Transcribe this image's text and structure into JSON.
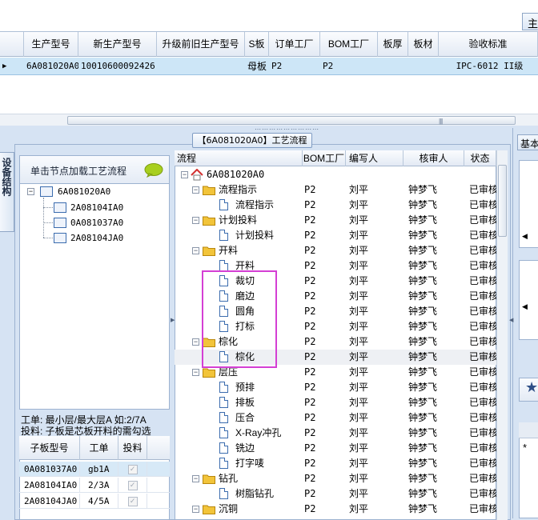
{
  "top": {
    "tab_label": "主",
    "columns": [
      "",
      "生产型号",
      "新生产型号",
      "升级前旧生产型号",
      "S板",
      "订单工厂",
      "BOM工厂",
      "板厚",
      "板材",
      "验收标准"
    ],
    "row": [
      "▶",
      "6A081020A0",
      "10010600092426",
      "",
      "母板",
      "P2",
      "P2",
      "",
      "",
      "IPC-6012 II级"
    ]
  },
  "panel": {
    "title": "【6A081020A0】工艺流程",
    "vertical_tab": "设备结构",
    "right_tab": "基本"
  },
  "left": {
    "header": "单击节点加载工艺流程",
    "tree": {
      "root": "6A081020A0",
      "children": [
        "2A08104IA0",
        "0A081037A0",
        "2A08104JA0"
      ]
    },
    "info_line1": "工单: 最小层/最大层A 如:2/7A",
    "info_line2": "投料: 子板是芯板开料的需勾选",
    "sub_columns": [
      "子板型号",
      "工单",
      "投料"
    ],
    "sub_rows": [
      [
        "0A081037A0",
        "gb1A",
        "✓"
      ],
      [
        "2A08104IA0",
        "2/3A",
        "✓"
      ],
      [
        "2A08104JA0",
        "4/5A",
        "✓"
      ]
    ]
  },
  "main": {
    "columns": [
      "流程",
      "BOM工厂",
      "编写人",
      "核审人",
      "状态"
    ],
    "rows": [
      {
        "level": 0,
        "type": "root",
        "name": "6A081020A0",
        "bom": "",
        "writer": "",
        "reviewer": "",
        "status": ""
      },
      {
        "level": 1,
        "type": "folder",
        "name": "流程指示",
        "bom": "P2",
        "writer": "刘平",
        "reviewer": "钟梦飞",
        "status": "已审核"
      },
      {
        "level": 2,
        "type": "doc",
        "name": "流程指示",
        "bom": "P2",
        "writer": "刘平",
        "reviewer": "钟梦飞",
        "status": "已审核"
      },
      {
        "level": 1,
        "type": "folder",
        "name": "计划投料",
        "bom": "P2",
        "writer": "刘平",
        "reviewer": "钟梦飞",
        "status": "已审核"
      },
      {
        "level": 2,
        "type": "doc",
        "name": "计划投料",
        "bom": "P2",
        "writer": "刘平",
        "reviewer": "钟梦飞",
        "status": "已审核"
      },
      {
        "level": 1,
        "type": "folder",
        "name": "开料",
        "bom": "P2",
        "writer": "刘平",
        "reviewer": "钟梦飞",
        "status": "已审核"
      },
      {
        "level": 2,
        "type": "doc",
        "name": "开料",
        "bom": "P2",
        "writer": "刘平",
        "reviewer": "钟梦飞",
        "status": "已审核"
      },
      {
        "level": 2,
        "type": "doc",
        "name": "裁切",
        "bom": "P2",
        "writer": "刘平",
        "reviewer": "钟梦飞",
        "status": "已审核"
      },
      {
        "level": 2,
        "type": "doc",
        "name": "磨边",
        "bom": "P2",
        "writer": "刘平",
        "reviewer": "钟梦飞",
        "status": "已审核"
      },
      {
        "level": 2,
        "type": "doc",
        "name": "圆角",
        "bom": "P2",
        "writer": "刘平",
        "reviewer": "钟梦飞",
        "status": "已审核"
      },
      {
        "level": 2,
        "type": "doc",
        "name": "打标",
        "bom": "P2",
        "writer": "刘平",
        "reviewer": "钟梦飞",
        "status": "已审核"
      },
      {
        "level": 1,
        "type": "folder",
        "name": "棕化",
        "bom": "P2",
        "writer": "刘平",
        "reviewer": "钟梦飞",
        "status": "已审核"
      },
      {
        "level": 2,
        "type": "doc",
        "name": "棕化",
        "bom": "P2",
        "writer": "刘平",
        "reviewer": "钟梦飞",
        "status": "已审核",
        "selected": true
      },
      {
        "level": 1,
        "type": "folder",
        "name": "层压",
        "bom": "P2",
        "writer": "刘平",
        "reviewer": "钟梦飞",
        "status": "已审核"
      },
      {
        "level": 2,
        "type": "doc",
        "name": "预排",
        "bom": "P2",
        "writer": "刘平",
        "reviewer": "钟梦飞",
        "status": "已审核"
      },
      {
        "level": 2,
        "type": "doc",
        "name": "排板",
        "bom": "P2",
        "writer": "刘平",
        "reviewer": "钟梦飞",
        "status": "已审核"
      },
      {
        "level": 2,
        "type": "doc",
        "name": "压合",
        "bom": "P2",
        "writer": "刘平",
        "reviewer": "钟梦飞",
        "status": "已审核"
      },
      {
        "level": 2,
        "type": "doc",
        "name": "X-Ray冲孔",
        "bom": "P2",
        "writer": "刘平",
        "reviewer": "钟梦飞",
        "status": "已审核"
      },
      {
        "level": 2,
        "type": "doc",
        "name": "铣边",
        "bom": "P2",
        "writer": "刘平",
        "reviewer": "钟梦飞",
        "status": "已审核"
      },
      {
        "level": 2,
        "type": "doc",
        "name": "打字唛",
        "bom": "P2",
        "writer": "刘平",
        "reviewer": "钟梦飞",
        "status": "已审核"
      },
      {
        "level": 1,
        "type": "folder",
        "name": "钻孔",
        "bom": "P2",
        "writer": "刘平",
        "reviewer": "钟梦飞",
        "status": "已审核"
      },
      {
        "level": 2,
        "type": "doc",
        "name": "树脂钻孔",
        "bom": "P2",
        "writer": "刘平",
        "reviewer": "钟梦飞",
        "status": "已审核"
      },
      {
        "level": 1,
        "type": "folder",
        "name": "沉铜",
        "bom": "P2",
        "writer": "刘平",
        "reviewer": "钟梦飞",
        "status": "已审核"
      }
    ]
  },
  "colors": {
    "accent_selection": "#cde6f7",
    "highlight_box": "#d43fd4",
    "folder": "#f2c43a"
  }
}
